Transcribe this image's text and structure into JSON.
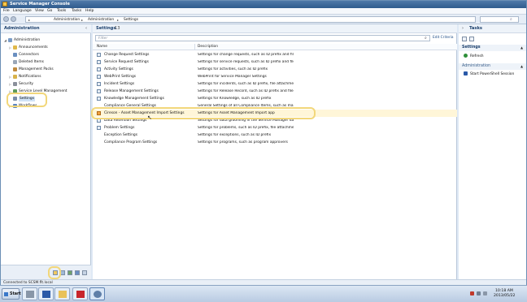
{
  "window": {
    "title": "Service Manager Console"
  },
  "menu": [
    "File",
    "Language",
    "View",
    "Go",
    "Tools",
    "Tasks",
    "Help"
  ],
  "breadcrumb": [
    "Administration",
    "Administration",
    "Settings"
  ],
  "left_pane": {
    "title": "Administration",
    "items": [
      {
        "label": "Administration",
        "expander": "◢",
        "color": "#7a9cc7"
      },
      {
        "label": "Announcements",
        "expander": "▷",
        "color": "#e0b84a"
      },
      {
        "label": "Connectors",
        "expander": "",
        "color": "#6a8fc0"
      },
      {
        "label": "Deleted Items",
        "expander": "",
        "color": "#9aa7b8"
      },
      {
        "label": "Management Packs",
        "expander": "",
        "color": "#c08a3e"
      },
      {
        "label": "Notifications",
        "expander": "▷",
        "color": "#d8b24a"
      },
      {
        "label": "Security",
        "expander": "▷",
        "color": "#8a8f9a"
      },
      {
        "label": "Service Level Management",
        "expander": "▷",
        "color": "#5f9a5a"
      },
      {
        "label": "Settings",
        "expander": "",
        "color": "#7a8ea8"
      },
      {
        "label": "Workflows",
        "expander": "▷",
        "color": "#5a84c0"
      }
    ]
  },
  "center": {
    "title": "Settings",
    "count": "13",
    "filter_placeholder": "Filter",
    "edit_criteria": "Edit Criteria",
    "columns": [
      "Name",
      "Description"
    ],
    "rows": [
      {
        "name": "Change Request Settings",
        "desc": "Settings for change requests, such as ID prefix and file a..."
      },
      {
        "name": "Service Request Settings",
        "desc": "Settings for service requests, such as ID prefix and file at..."
      },
      {
        "name": "Activity Settings",
        "desc": "Settings for activities, such as ID prefix"
      },
      {
        "name": "WebPrint Settings",
        "desc": "WebPrint for Service Manager Settings"
      },
      {
        "name": "Incident Settings",
        "desc": "Settings for incidents, such as ID prefix, file attachments,..."
      },
      {
        "name": "Release Management Settings",
        "desc": "Settings for Release Record, such as ID prefix and file att..."
      },
      {
        "name": "Knowledge Management Settings",
        "desc": "Settings for Knowledge, such as ID prefix"
      },
      {
        "name": "Compliance General Settings",
        "desc": "General Settings of all Compliance Items, such as maxim..."
      },
      {
        "name": "Cireson - Asset Management Import Settings",
        "desc": "Settings for Asset Management Import app"
      },
      {
        "name": "Data Retention Settings",
        "desc": "Settings for data grooming in the Service Manager datab..."
      },
      {
        "name": "Problem Settings",
        "desc": "Settings for problems, such as ID prefix, file attachments..."
      },
      {
        "name": "Exception Settings",
        "desc": "Settings for exceptions, such as ID prefix"
      },
      {
        "name": "Compliance Program Settings",
        "desc": "Settings for programs, such as program approvers"
      }
    ]
  },
  "right_pane": {
    "title": "Tasks",
    "section1": "Settings",
    "task1": "Refresh",
    "section2": "Administration",
    "task2": "Start PowerShell Session"
  },
  "status": "Connected to SCSM.flt.local",
  "taskbar": {
    "start": "Start",
    "time": "10:18 AM",
    "date": "2013/05/22"
  }
}
